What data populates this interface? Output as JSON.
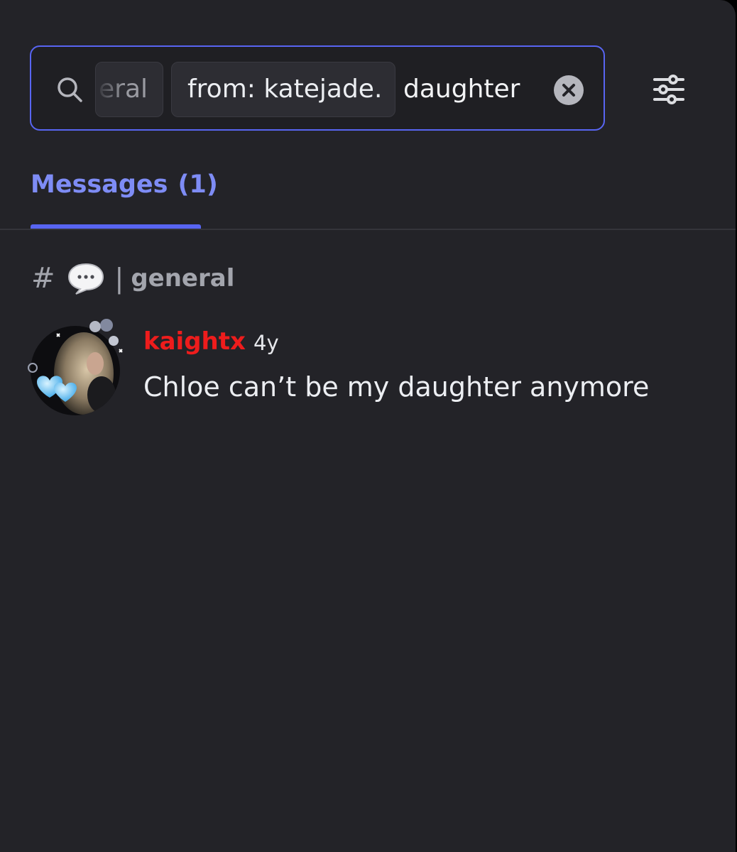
{
  "search": {
    "channel_chip": "eral",
    "from_chip": "from: katejade.",
    "query": "daughter"
  },
  "tabs": {
    "messages_label": "Messages",
    "messages_count": "(1)"
  },
  "channel": {
    "hash": "#",
    "separator": "|",
    "name": "general"
  },
  "message": {
    "author": "kaightx",
    "timestamp": "4y",
    "text": "Chloe can’t be my daughter anymore"
  },
  "icons": {
    "search": "search-icon",
    "clear": "clear-x-icon",
    "filter": "sliders-icon",
    "channel_emoji": "speech-bubble-icon"
  },
  "colors": {
    "accent": "#5865f2",
    "tab_active": "#7e8cf5",
    "author": "#ee1c1c",
    "background": "#232328"
  }
}
